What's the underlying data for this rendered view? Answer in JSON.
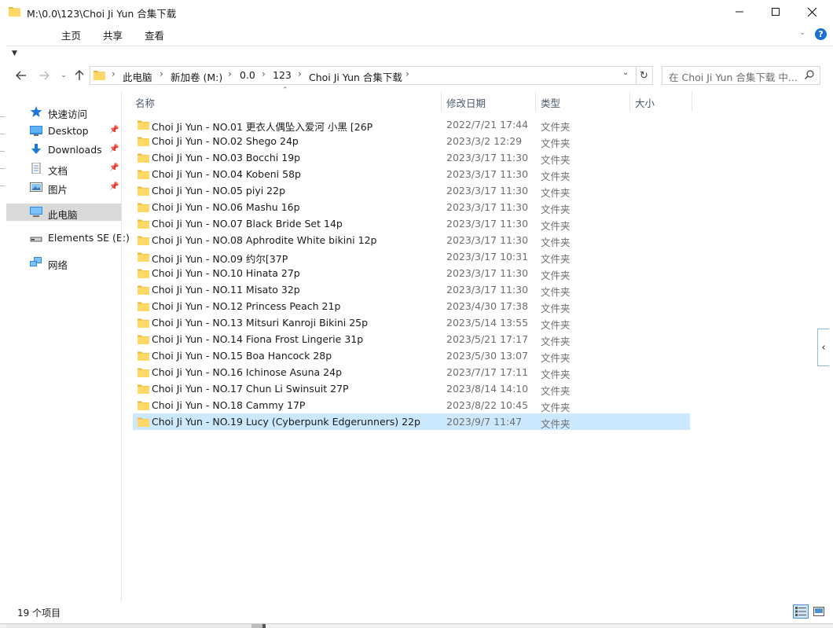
{
  "window": {
    "title": "M:\\0.0\\123\\Choi Ji Yun 合集下载"
  },
  "ribbon": {
    "tabs": [
      "主页",
      "共享",
      "查看"
    ],
    "help": "?"
  },
  "address_bar": {
    "crumbs": [
      "此电脑",
      "新加卷 (M:)",
      "0.0",
      "123",
      "Choi Ji Yun 合集下载"
    ]
  },
  "search": {
    "placeholder": "在 Choi Ji Yun 合集下载 中..."
  },
  "nav_pane": {
    "items": [
      {
        "label": "快速访问",
        "icon": "star-icon",
        "pinned": false
      },
      {
        "label": "Desktop",
        "icon": "desktop-icon",
        "pinned": true
      },
      {
        "label": "Downloads",
        "icon": "download-icon",
        "pinned": true
      },
      {
        "label": "文档",
        "icon": "document-icon",
        "pinned": true
      },
      {
        "label": "图片",
        "icon": "pictures-icon",
        "pinned": true
      },
      {
        "label": "此电脑",
        "icon": "computer-icon",
        "pinned": false,
        "selected": true
      },
      {
        "label": "Elements SE (E:)",
        "icon": "drive-icon",
        "pinned": false
      },
      {
        "label": "网络",
        "icon": "network-icon",
        "pinned": false
      }
    ]
  },
  "columns": {
    "name": "名称",
    "date": "修改日期",
    "type": "类型",
    "size": "大小"
  },
  "files": [
    {
      "name": "Choi Ji Yun - NO.01 更衣人偶坠入爱河 小黑 [26P",
      "date": "2022/7/21 17:44",
      "type": "文件夹"
    },
    {
      "name": "Choi Ji Yun - NO.02 Shego 24p",
      "date": "2023/3/2 12:29",
      "type": "文件夹"
    },
    {
      "name": "Choi Ji Yun - NO.03 Bocchi 19p",
      "date": "2023/3/17 11:30",
      "type": "文件夹"
    },
    {
      "name": "Choi Ji Yun - NO.04 Kobeni 58p",
      "date": "2023/3/17 11:30",
      "type": "文件夹"
    },
    {
      "name": "Choi Ji Yun - NO.05 piyi 22p",
      "date": "2023/3/17 11:30",
      "type": "文件夹"
    },
    {
      "name": "Choi Ji Yun - NO.06 Mashu 16p",
      "date": "2023/3/17 11:30",
      "type": "文件夹"
    },
    {
      "name": "Choi Ji Yun - NO.07 Black Bride Set 14p",
      "date": "2023/3/17 11:30",
      "type": "文件夹"
    },
    {
      "name": "Choi Ji Yun - NO.08 Aphrodite White bikini 12p",
      "date": "2023/3/17 11:30",
      "type": "文件夹"
    },
    {
      "name": "Choi Ji Yun - NO.09 约尔[37P",
      "date": "2023/3/17 10:31",
      "type": "文件夹"
    },
    {
      "name": "Choi Ji Yun - NO.10 Hinata 27p",
      "date": "2023/3/17 11:30",
      "type": "文件夹"
    },
    {
      "name": "Choi Ji Yun - NO.11 Misato 32p",
      "date": "2023/3/17 11:30",
      "type": "文件夹"
    },
    {
      "name": "Choi Ji Yun - NO.12 Princess Peach 21p",
      "date": "2023/4/30 17:38",
      "type": "文件夹"
    },
    {
      "name": "Choi Ji Yun - NO.13 Mitsuri Kanroji Bikini 25p",
      "date": "2023/5/14 13:55",
      "type": "文件夹"
    },
    {
      "name": "Choi Ji Yun - NO.14 Fiona Frost Lingerie 31p",
      "date": "2023/5/21 17:17",
      "type": "文件夹"
    },
    {
      "name": "Choi Ji Yun - NO.15 Boa Hancock 28p",
      "date": "2023/5/30 13:07",
      "type": "文件夹"
    },
    {
      "name": "Choi Ji Yun - NO.16 Ichinose Asuna 24p",
      "date": "2023/7/17 17:11",
      "type": "文件夹"
    },
    {
      "name": "Choi Ji Yun - NO.17 Chun Li Swinsuit 27P",
      "date": "2023/8/14 14:10",
      "type": "文件夹"
    },
    {
      "name": "Choi Ji Yun - NO.18 Cammy 17P",
      "date": "2023/8/22 10:45",
      "type": "文件夹"
    },
    {
      "name": "Choi Ji Yun - NO.19 Lucy (Cyberpunk Edgerunners) 22p",
      "date": "2023/9/7 11:47",
      "type": "文件夹",
      "selected": true
    }
  ],
  "status": {
    "item_count": "19 个项目"
  },
  "colors": {
    "folder_yellow": "#ffd865",
    "folder_dark": "#e9b737",
    "selection": "#cce8ff",
    "nav_selected": "#d9d9d9",
    "accent_blue": "#1c6ed4"
  }
}
